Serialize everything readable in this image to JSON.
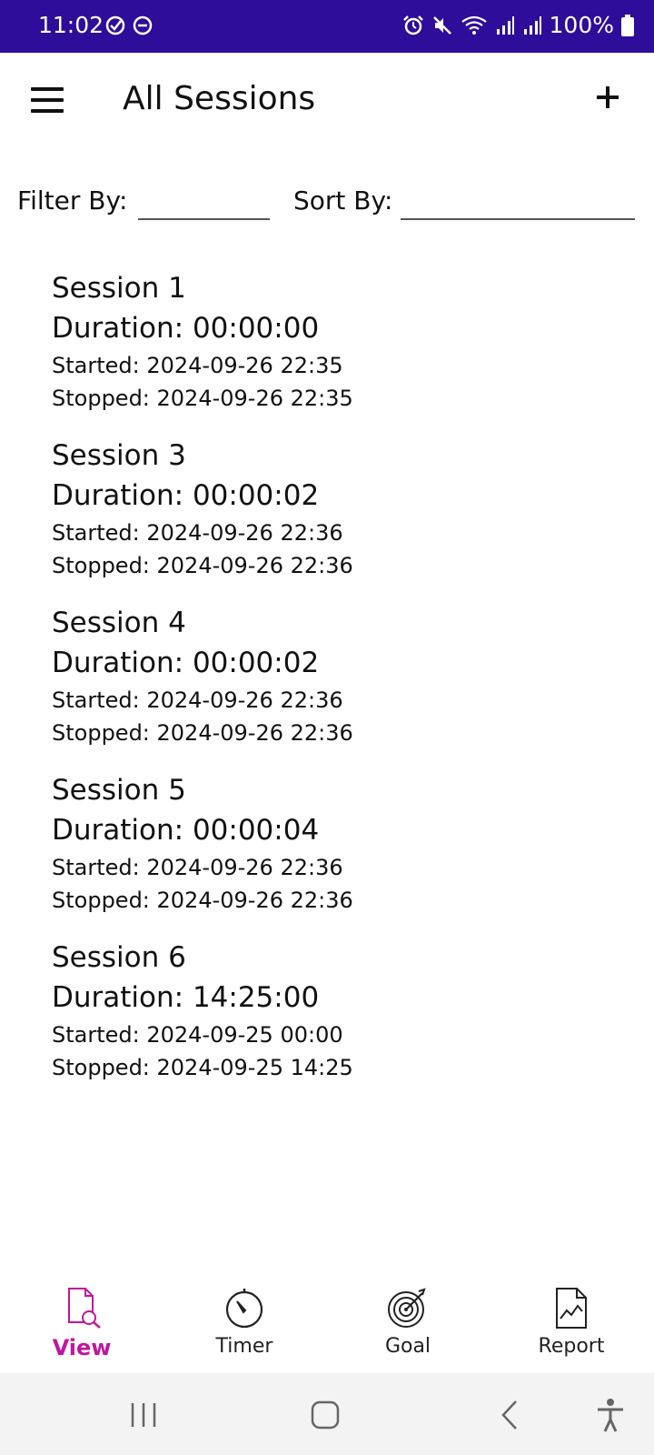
{
  "status_bar": {
    "time": "11:02",
    "battery": "100%"
  },
  "app_bar": {
    "title": "All Sessions"
  },
  "filters": {
    "filter_label": "Filter By:",
    "filter_value": "",
    "sort_label": "Sort By:",
    "sort_value": ""
  },
  "sessions": [
    {
      "name": "Session 1",
      "duration": "Duration: 00:00:00",
      "started": "Started: 2024-09-26 22:35",
      "stopped": "Stopped: 2024-09-26 22:35"
    },
    {
      "name": "Session 3",
      "duration": "Duration: 00:00:02",
      "started": "Started: 2024-09-26 22:36",
      "stopped": "Stopped: 2024-09-26 22:36"
    },
    {
      "name": "Session 4",
      "duration": "Duration: 00:00:02",
      "started": "Started: 2024-09-26 22:36",
      "stopped": "Stopped: 2024-09-26 22:36"
    },
    {
      "name": "Session 5",
      "duration": "Duration: 00:00:04",
      "started": "Started: 2024-09-26 22:36",
      "stopped": "Stopped: 2024-09-26 22:36"
    },
    {
      "name": "Session 6",
      "duration": "Duration: 14:25:00",
      "started": "Started: 2024-09-25 00:00",
      "stopped": "Stopped: 2024-09-25 14:25"
    }
  ],
  "bottom_nav": {
    "items": [
      {
        "label": "View",
        "icon": "document-search-icon",
        "active": true
      },
      {
        "label": "Timer",
        "icon": "stopwatch-icon",
        "active": false
      },
      {
        "label": "Goal",
        "icon": "target-icon",
        "active": false
      },
      {
        "label": "Report",
        "icon": "report-chart-icon",
        "active": false
      }
    ]
  },
  "colors": {
    "status_bar": "#2e0d9a",
    "accent": "#c0179b",
    "text": "#111111",
    "system_nav": "#f3f3f3"
  }
}
